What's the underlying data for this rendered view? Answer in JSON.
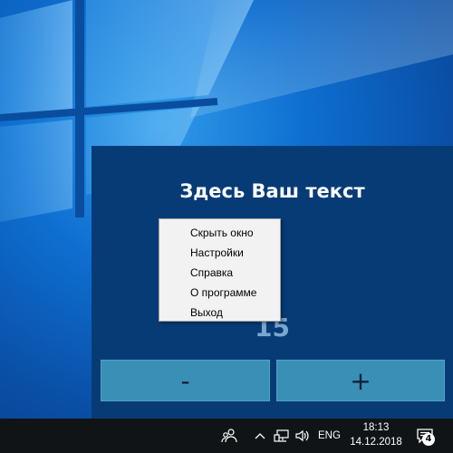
{
  "app": {
    "title": "Здесь Ваш текст",
    "counter": "15",
    "minus_label": "-",
    "plus_label": "+"
  },
  "context_menu": {
    "items": [
      {
        "label": "Скрыть окно"
      },
      {
        "label": "Настройки"
      },
      {
        "label": "Справка"
      },
      {
        "label": "О программе"
      },
      {
        "label": "Выход"
      }
    ]
  },
  "taskbar": {
    "language": "ENG",
    "time": "18:13",
    "date": "14.12.2018",
    "notification_count": "4",
    "icons": [
      "people-icon",
      "chevron-up-icon",
      "network-icon",
      "volume-icon",
      "action-center-icon"
    ]
  },
  "colors": {
    "app_background": "#073b76",
    "button": "#3a8fb6",
    "taskbar": "#101417"
  }
}
